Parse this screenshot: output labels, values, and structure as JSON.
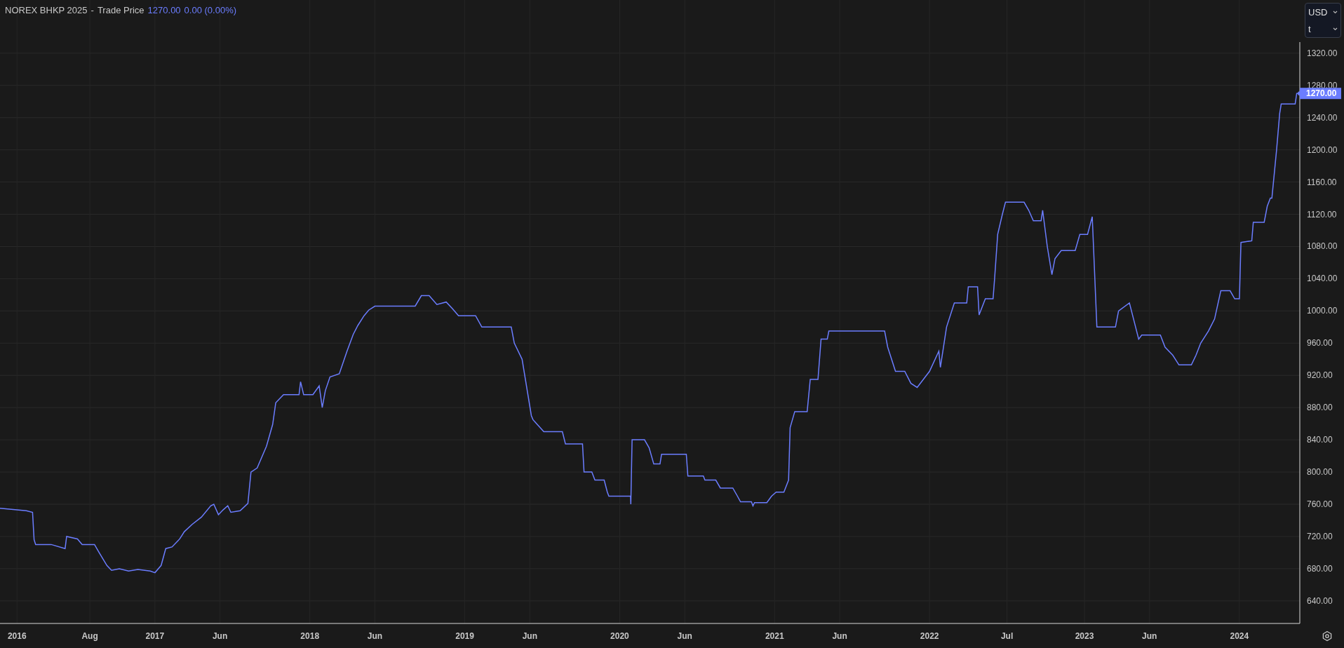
{
  "header": {
    "symbol": "NOREX BHKP 2025",
    "separator": "-",
    "last_price": "1270.00",
    "change": "0.00 (0.00%)"
  },
  "selectors": [
    {
      "value": "USD"
    },
    {
      "value": "t"
    }
  ],
  "chart": {
    "price_label": "1270.00",
    "chart_data": {
      "type": "line",
      "x": [
        2016.0,
        2016.17,
        2016.21,
        2016.22,
        2016.23,
        2016.33,
        2016.42,
        2016.43,
        2016.5,
        2016.53,
        2016.61,
        2016.64,
        2016.69,
        2016.72,
        2016.77,
        2016.83,
        2016.89,
        2016.97,
        2017.0,
        2017.04,
        2017.07,
        2017.11,
        2017.16,
        2017.19,
        2017.24,
        2017.3,
        2017.36,
        2017.38,
        2017.41,
        2017.44,
        2017.47,
        2017.49,
        2017.55,
        2017.6,
        2017.62,
        2017.66,
        2017.72,
        2017.76,
        2017.78,
        2017.83,
        2017.93,
        2017.94,
        2017.96,
        2018.02,
        2018.06,
        2018.08,
        2018.1,
        2018.13,
        2018.19,
        2018.24,
        2018.28,
        2018.31,
        2018.35,
        2018.38,
        2018.42,
        2018.68,
        2018.72,
        2018.77,
        2018.82,
        2018.88,
        2018.92,
        2018.96,
        2019.07,
        2019.11,
        2019.3,
        2019.32,
        2019.37,
        2019.43,
        2019.44,
        2019.51,
        2019.63,
        2019.65,
        2019.76,
        2019.77,
        2019.82,
        2019.84,
        2019.9,
        2019.92,
        2019.93,
        2020.07,
        2020.072,
        2020.08,
        2020.16,
        2020.19,
        2020.22,
        2020.26,
        2020.27,
        2020.43,
        2020.44,
        2020.54,
        2020.55,
        2020.62,
        2020.65,
        2020.73,
        2020.76,
        2020.78,
        2020.85,
        2020.86,
        2020.87,
        2020.95,
        2020.98,
        2021.01,
        2021.06,
        2021.09,
        2021.1,
        2021.13,
        2021.21,
        2021.23,
        2021.28,
        2021.3,
        2021.34,
        2021.35,
        2021.71,
        2021.73,
        2021.78,
        2021.84,
        2021.88,
        2021.92,
        2021.96,
        2022.0,
        2022.06,
        2022.07,
        2022.11,
        2022.16,
        2022.24,
        2022.25,
        2022.31,
        2022.32,
        2022.36,
        2022.41,
        2022.42,
        2022.44,
        2022.47,
        2022.49,
        2022.61,
        2022.64,
        2022.67,
        2022.72,
        2022.73,
        2022.76,
        2022.79,
        2022.81,
        2022.85,
        2022.94,
        2022.97,
        2023.02,
        2023.05,
        2023.08,
        2023.2,
        2023.22,
        2023.29,
        2023.31,
        2023.35,
        2023.37,
        2023.49,
        2023.52,
        2023.57,
        2023.61,
        2023.69,
        2023.72,
        2023.75,
        2023.8,
        2023.84,
        2023.88,
        2023.94,
        2023.97,
        2024.0,
        2024.01,
        2024.08,
        2024.09,
        2024.16,
        2024.18,
        2024.2,
        2024.21,
        2024.24,
        2024.26,
        2024.27,
        2024.36,
        2024.37,
        2024.39
      ],
      "series": [
        {
          "name": "Trade Price",
          "color": "#6b7dff",
          "values": [
            755,
            752,
            750,
            716,
            710,
            710,
            705,
            720,
            717,
            710,
            710,
            700,
            684,
            678,
            680,
            677,
            679,
            677,
            675,
            684,
            705,
            707,
            717,
            726,
            735,
            744,
            758,
            760,
            747,
            753,
            758,
            750,
            752,
            761,
            800,
            805,
            832,
            859,
            886,
            896,
            896,
            912,
            896,
            896,
            907,
            880,
            901,
            918,
            922,
            950,
            971,
            982,
            994,
            1001,
            1006,
            1006,
            1019,
            1019,
            1008,
            1011,
            1003,
            994,
            994,
            980,
            980,
            960,
            940,
            870,
            865,
            850,
            850,
            835,
            835,
            800,
            800,
            790,
            790,
            775,
            770,
            770,
            760,
            840,
            840,
            830,
            810,
            810,
            822,
            822,
            795,
            795,
            790,
            790,
            780,
            780,
            770,
            763,
            763,
            758,
            762,
            762,
            770,
            775,
            775,
            790,
            855,
            875,
            875,
            915,
            915,
            965,
            965,
            975,
            975,
            955,
            925,
            925,
            910,
            905,
            915,
            925,
            950,
            930,
            980,
            1010,
            1010,
            1030,
            1030,
            995,
            1015,
            1015,
            1040,
            1095,
            1120,
            1135,
            1135,
            1125,
            1112,
            1112,
            1125,
            1080,
            1045,
            1065,
            1075,
            1075,
            1095,
            1095,
            1117,
            980,
            980,
            1000,
            1010,
            995,
            965,
            970,
            970,
            955,
            945,
            933,
            933,
            945,
            960,
            975,
            990,
            1025,
            1025,
            1015,
            1015,
            1085,
            1087,
            1110,
            1110,
            1130,
            1140,
            1140,
            1200,
            1245,
            1257,
            1257,
            1270,
            1270
          ]
        }
      ],
      "grid": true,
      "xlim": [
        2016.0,
        2024.39
      ],
      "ylim": [
        612,
        1386
      ],
      "xticks": [
        {
          "value": 2016.11,
          "label": "2016"
        },
        {
          "value": 2016.58,
          "label": "Aug"
        },
        {
          "value": 2017,
          "label": "2017"
        },
        {
          "value": 2017.42,
          "label": "Jun"
        },
        {
          "value": 2018,
          "label": "2018"
        },
        {
          "value": 2018.42,
          "label": "Jun"
        },
        {
          "value": 2019,
          "label": "2019"
        },
        {
          "value": 2019.42,
          "label": "Jun"
        },
        {
          "value": 2020,
          "label": "2020"
        },
        {
          "value": 2020.42,
          "label": "Jun"
        },
        {
          "value": 2021,
          "label": "2021"
        },
        {
          "value": 2021.42,
          "label": "Jun"
        },
        {
          "value": 2022,
          "label": "2022"
        },
        {
          "value": 2022.5,
          "label": "Jul"
        },
        {
          "value": 2023,
          "label": "2023"
        },
        {
          "value": 2023.42,
          "label": "Jun"
        },
        {
          "value": 2024,
          "label": "2024"
        }
      ],
      "yticks": [
        {
          "value": 640,
          "label": "640.00"
        },
        {
          "value": 680,
          "label": "680.00"
        },
        {
          "value": 720,
          "label": "720.00"
        },
        {
          "value": 760,
          "label": "760.00"
        },
        {
          "value": 800,
          "label": "800.00"
        },
        {
          "value": 840,
          "label": "840.00"
        },
        {
          "value": 880,
          "label": "880.00"
        },
        {
          "value": 920,
          "label": "920.00"
        },
        {
          "value": 960,
          "label": "960.00"
        },
        {
          "value": 1000,
          "label": "1000.00"
        },
        {
          "value": 1040,
          "label": "1040.00"
        },
        {
          "value": 1080,
          "label": "1080.00"
        },
        {
          "value": 1120,
          "label": "1120.00"
        },
        {
          "value": 1160,
          "label": "1160.00"
        },
        {
          "value": 1200,
          "label": "1200.00"
        },
        {
          "value": 1240,
          "label": "1240.00"
        },
        {
          "value": 1280,
          "label": "1280.00"
        },
        {
          "value": 1320,
          "label": "1320.00"
        }
      ]
    }
  }
}
